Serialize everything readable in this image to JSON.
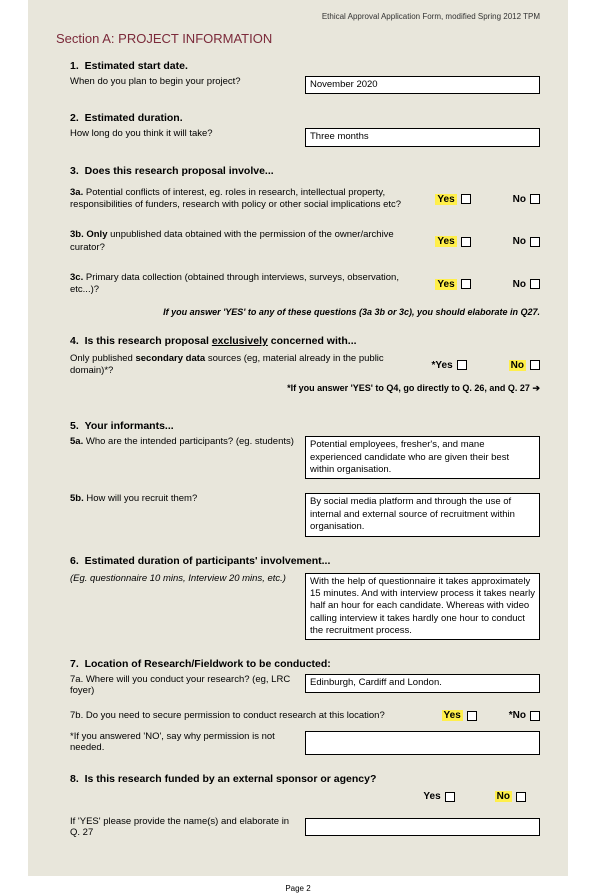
{
  "header": "Ethical Approval Application Form, modified Spring 2012  TPM",
  "section": "Section A: PROJECT INFORMATION",
  "q1": {
    "num": "1.",
    "title": "Estimated start date.",
    "sub": "When do you plan to begin your project?",
    "value": "November 2020"
  },
  "q2": {
    "num": "2.",
    "title": "Estimated duration.",
    "sub": "How long do you think it will take?",
    "value": "Three months"
  },
  "q3": {
    "num": "3.",
    "title": "Does this research proposal involve...",
    "a_label": "3a.",
    "a_text": "Potential conflicts of interest, eg. roles in research, intellectual property, responsibilities of funders, research with policy or other social implications etc?",
    "b_label": "3b. Only",
    "b_text": " unpublished data obtained with the permission of the owner/archive curator?",
    "c_label": "3c.",
    "c_text": "Primary data collection (obtained through interviews, surveys, observation, etc...)?",
    "yes": "Yes",
    "no": "No",
    "note": "If you answer 'YES' to any of these questions (3a 3b or 3c), you should elaborate in Q27."
  },
  "q4": {
    "num": "4.",
    "title_a": "Is this research proposal ",
    "title_u": "exclusively",
    "title_b": " concerned with...",
    "sub_a": "Only published ",
    "sub_b": "secondary data",
    "sub_c": " sources (eg, material already in the public domain)*?",
    "yes": "*Yes",
    "no": "No",
    "note": "*If you answer 'YES' to Q4, go directly to Q. 26, and Q. 27",
    "arrow": "➔"
  },
  "q5": {
    "num": "5.",
    "title": "Your informants...",
    "a_label": "5a.",
    "a_text": "Who are the intended participants?  (eg. students)",
    "a_value": "Potential employees, fresher's, and mane experienced candidate who are given their best within organisation.",
    "b_label": "5b.",
    "b_text": "How will you recruit them?",
    "b_value": "By social media platform and through the use of internal and external source of recruitment within organisation."
  },
  "q6": {
    "num": "6.",
    "title": "Estimated duration of participants' involvement...",
    "eg": "(Eg. questionnaire 10 mins, Interview 20 mins, etc.)",
    "value": "With the help of questionnaire it takes approximately 15 minutes. And with interview process it takes nearly half an hour for each candidate. Whereas with video calling interview it takes hardly one hour to conduct the recruitment process."
  },
  "q7": {
    "num": "7.",
    "title": "Location of Research/Fieldwork to be conducted:",
    "a_text": "7a. Where will you conduct your research?  (eg, LRC foyer)",
    "a_value": "Edinburgh, Cardiff and London.",
    "b_text": "7b. Do you need to secure permission to conduct research at this location?",
    "b_yes": "Yes",
    "b_no": "*No",
    "c_text": "*If you answered 'NO', say why permission is not needed.",
    "c_value": ""
  },
  "q8": {
    "num": "8.",
    "title": "Is this research funded by an external sponsor or agency?",
    "yes": "Yes",
    "no": "No",
    "sub": "If 'YES' please provide the name(s) and elaborate in Q. 27",
    "value": ""
  },
  "page": "Page 2"
}
